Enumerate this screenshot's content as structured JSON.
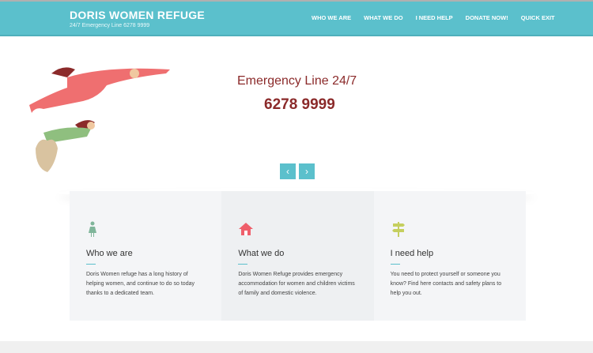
{
  "header": {
    "brand": "DORIS WOMEN REFUGE",
    "tagline": "24/7 Emergency Line 6278 9999",
    "nav": [
      "WHO WE ARE",
      "WHAT WE DO",
      "I NEED HELP",
      "DONATE NOW!",
      "QUICK EXIT"
    ]
  },
  "hero": {
    "title": "Emergency Line 24/7",
    "phone": "6278 9999",
    "prev": "‹",
    "next": "›"
  },
  "cards": [
    {
      "icon": "woman-icon",
      "title": "Who we are",
      "text": "Doris Women refuge has a long history of helping women, and continue to do so today thanks to a dedicated team.",
      "color": "#7fb59a"
    },
    {
      "icon": "home-icon",
      "title": "What we do",
      "text": "Doris Women Refuge provides emergency accommodation for women and children victims of family and domestic violence.",
      "color": "#ef5f6b"
    },
    {
      "icon": "signpost-icon",
      "title": "I need help",
      "text": "You need to protect yourself or someone you know? Find here contacts and safety plans to help you out.",
      "color": "#c5cf5f"
    }
  ]
}
